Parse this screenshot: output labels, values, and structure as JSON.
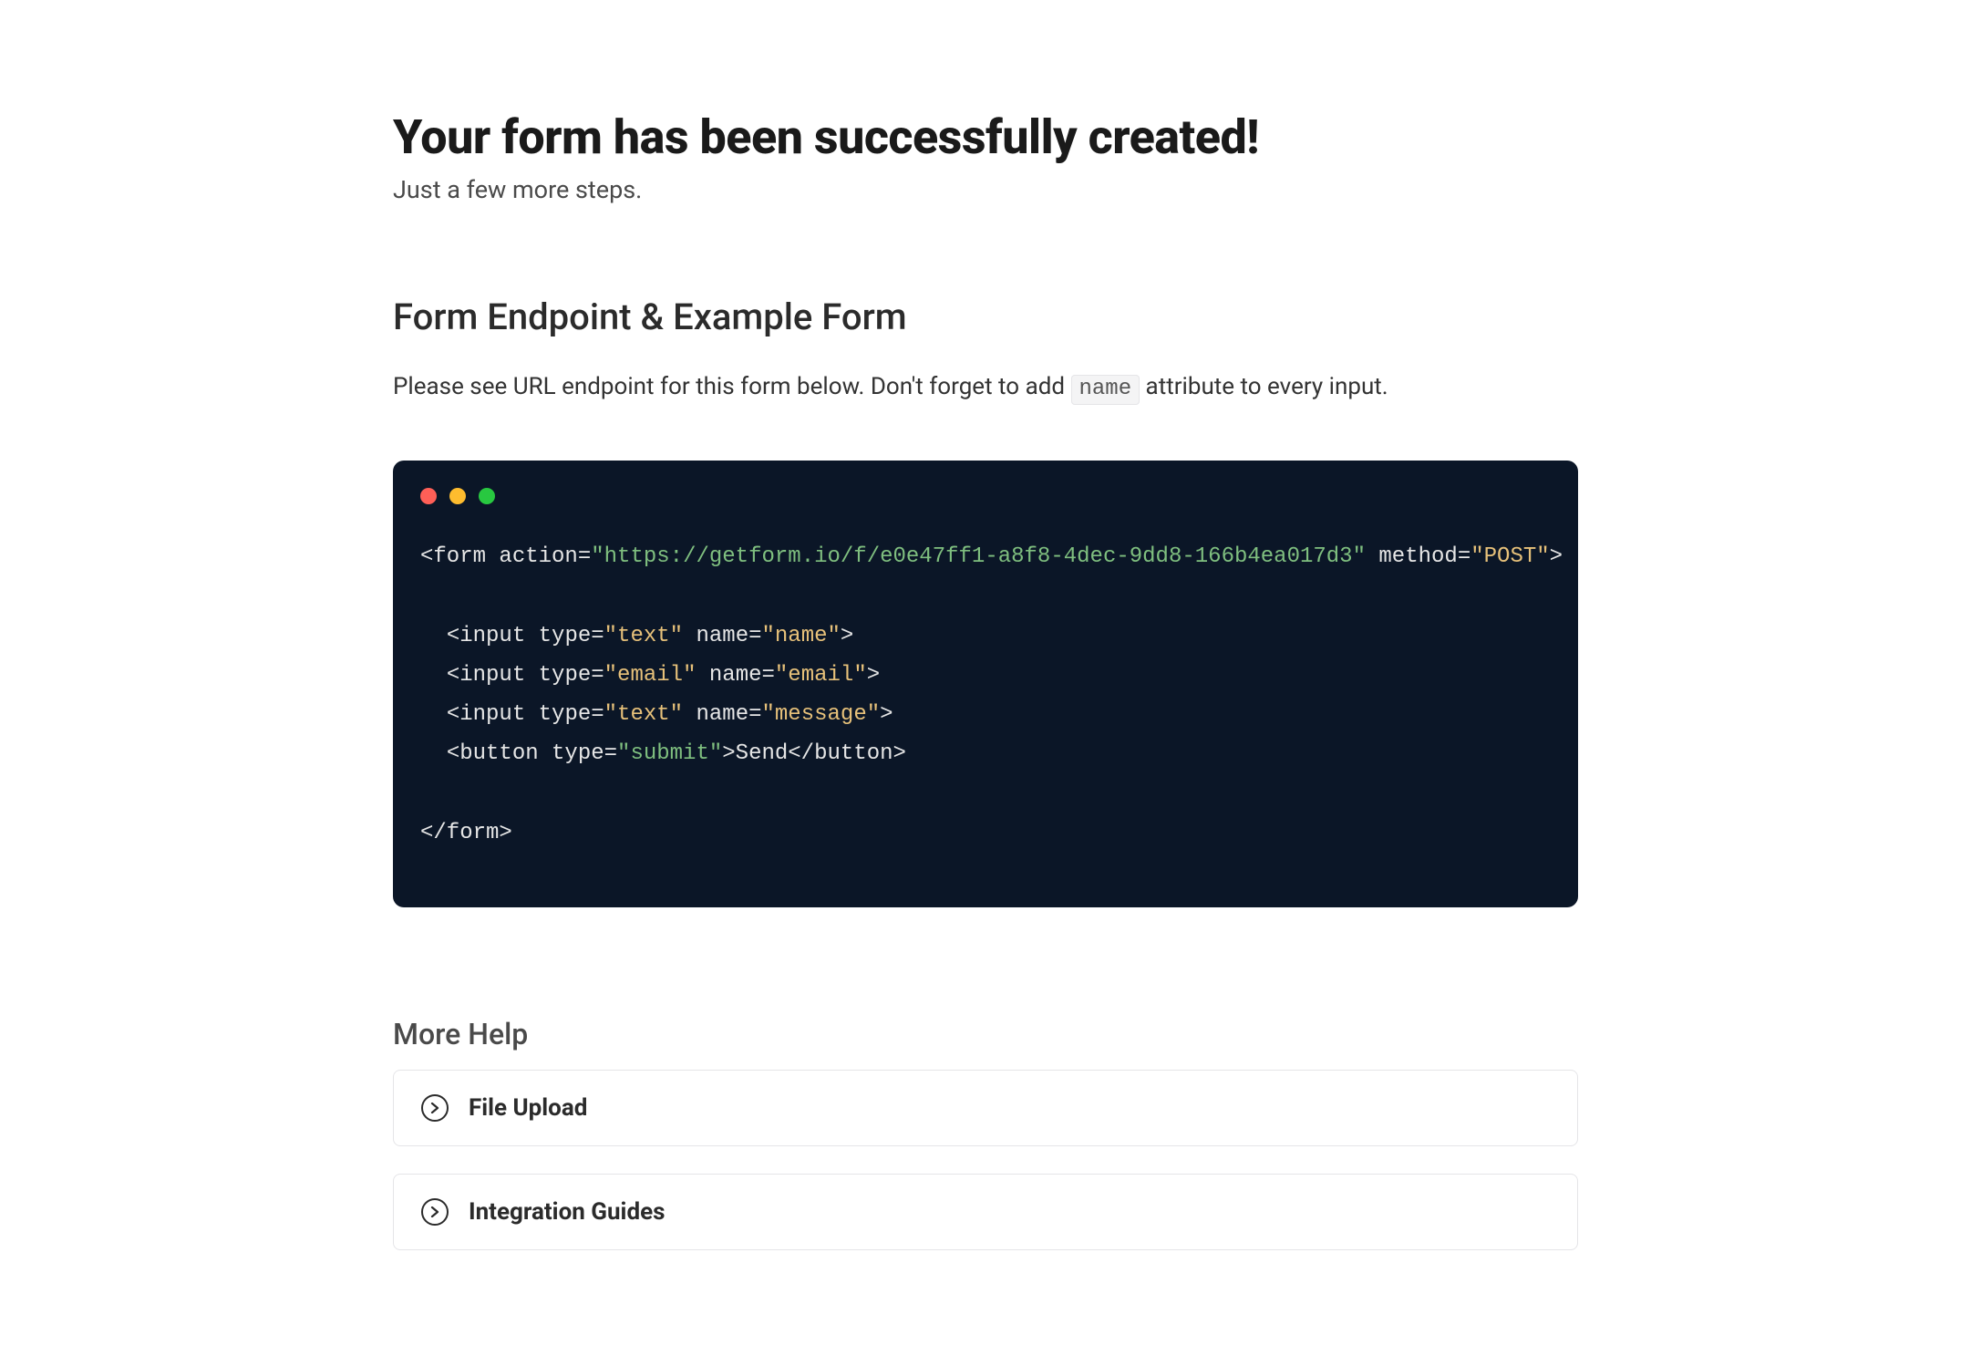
{
  "header": {
    "title": "Your form has been successfully created!",
    "subtitle": "Just a few more steps."
  },
  "endpoint": {
    "heading": "Form Endpoint & Example Form",
    "desc_before": "Please see URL endpoint for this form below. Don't forget to add ",
    "desc_code": "name",
    "desc_after": " attribute to every input.",
    "action_url": "https://getform.io/f/e0e47ff1-a8f8-4dec-9dd8-166b4ea017d3",
    "method": "POST",
    "inputs": [
      {
        "type": "text",
        "name": "name"
      },
      {
        "type": "email",
        "name": "email"
      },
      {
        "type": "text",
        "name": "message"
      }
    ],
    "button": {
      "type": "submit",
      "label": "Send"
    }
  },
  "help": {
    "heading": "More Help",
    "items": [
      {
        "label": "File Upload"
      },
      {
        "label": "Integration Guides"
      }
    ]
  }
}
